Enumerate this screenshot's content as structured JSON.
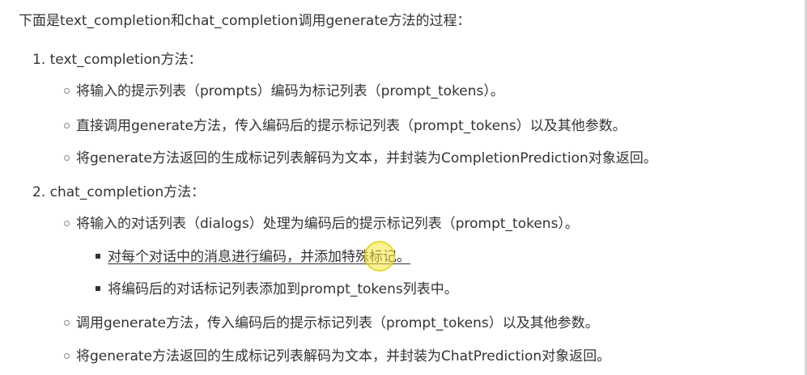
{
  "intro": "下面是text_completion和chat_completion调用generate方法的过程：",
  "sections": [
    {
      "heading": "1. text_completion方法：",
      "items": [
        "将输入的提示列表（prompts）编码为标记列表（prompt_tokens）。",
        "直接调用generate方法，传入编码后的提示标记列表（prompt_tokens）以及其他参数。",
        "将generate方法返回的生成标记列表解码为文本，并封装为CompletionPrediction对象返回。"
      ]
    },
    {
      "heading": "2. chat_completion方法：",
      "items": [
        "将输入的对话列表（dialogs）处理为编码后的提示标记列表（prompt_tokens）。",
        "调用generate方法，传入编码后的提示标记列表（prompt_tokens）以及其他参数。",
        "将generate方法返回的生成标记列表解码为文本，并封装为ChatPrediction对象返回。"
      ],
      "subitems": [
        "对每个对话中的消息进行编码，并添加特殊标记。",
        "将编码后的对话标记列表添加到prompt_tokens列表中。"
      ]
    }
  ]
}
